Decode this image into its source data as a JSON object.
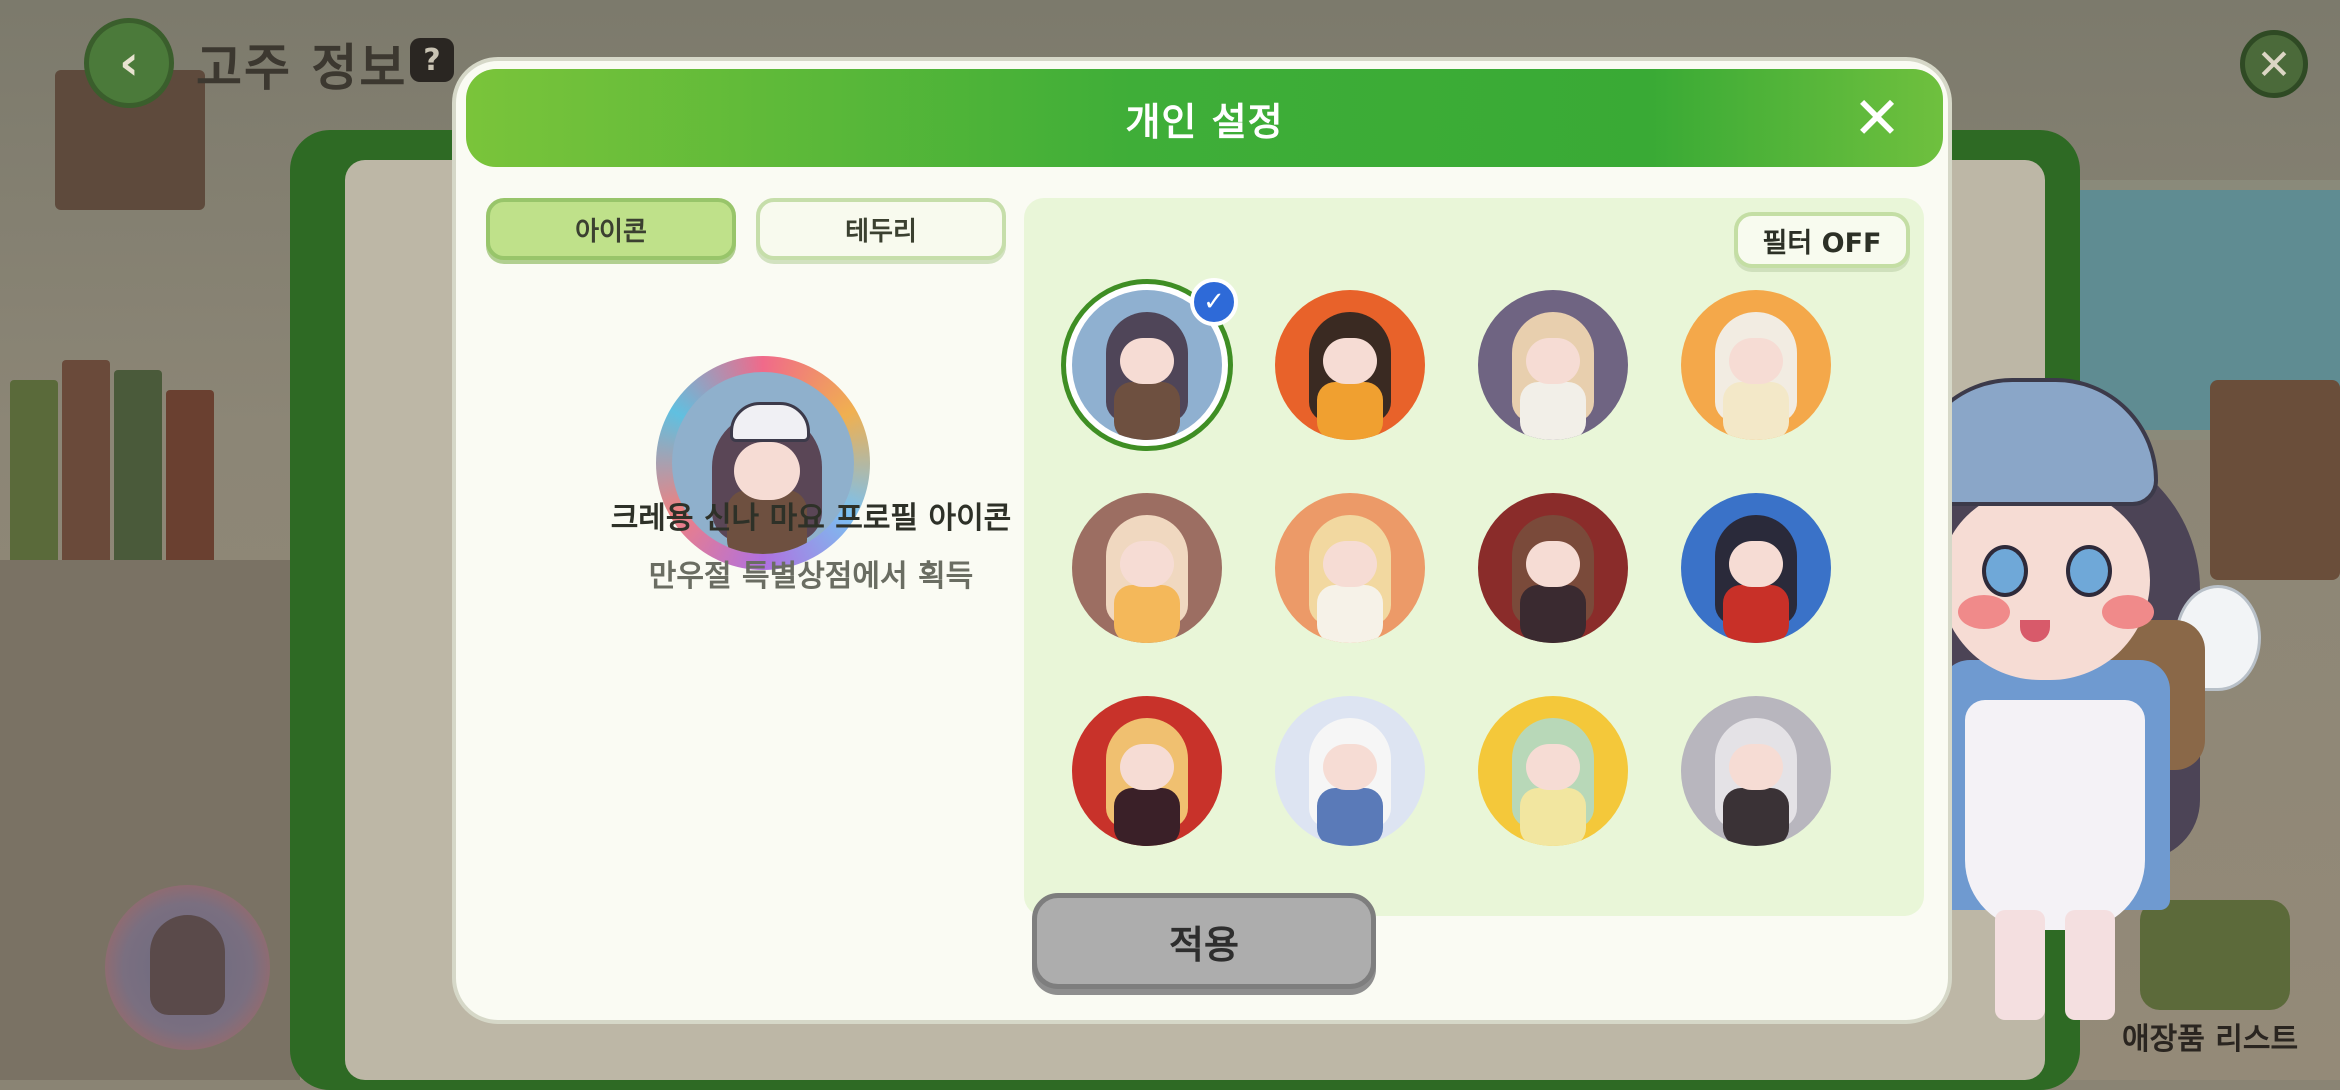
{
  "background": {
    "header_title": "고주 정보",
    "help_icon": "question-book-icon",
    "accessory_list_label": "애장품 리스트"
  },
  "modal": {
    "title": "개인 설정",
    "tabs": [
      {
        "label": "아이콘",
        "active": true
      },
      {
        "label": "테두리",
        "active": false
      }
    ],
    "selected_item": {
      "name": "크레용 신나 마요 프로필 아이콘",
      "source": "만우절 특별상점에서 획득"
    },
    "filter_label": "필터 OFF",
    "apply_label": "적용"
  },
  "icons": [
    {
      "id": "icon-1",
      "bg": "#8fb0d0",
      "hair": "#4f4558",
      "body": "#6e5040",
      "selected": true
    },
    {
      "id": "icon-2",
      "bg": "#e8622a",
      "hair": "#3a2a22",
      "body": "#f0a030",
      "selected": false
    },
    {
      "id": "icon-3",
      "bg": "#6f6482",
      "hair": "#e8cfae",
      "body": "#f2efe8",
      "selected": false
    },
    {
      "id": "icon-4",
      "bg": "#f4a84a",
      "hair": "#f2ece2",
      "body": "#f3e8c8",
      "selected": false
    },
    {
      "id": "icon-5",
      "bg": "#9c6e62",
      "hair": "#f0d8c0",
      "body": "#f4b85a",
      "selected": false
    },
    {
      "id": "icon-6",
      "bg": "#ec9a68",
      "hair": "#f2d8a0",
      "body": "#f6f2e8",
      "selected": false
    },
    {
      "id": "icon-7",
      "bg": "#8a2c2a",
      "hair": "#7a4a3a",
      "body": "#3a2a30",
      "selected": false
    },
    {
      "id": "icon-8",
      "bg": "#3a72c8",
      "hair": "#2a2a3a",
      "body": "#c83028",
      "selected": false
    },
    {
      "id": "icon-9",
      "bg": "#c8322a",
      "hair": "#f0c070",
      "body": "#3a2028",
      "selected": false
    },
    {
      "id": "icon-10",
      "bg": "#dde4f2",
      "hair": "#f6f6f6",
      "body": "#5a7ab8",
      "selected": false
    },
    {
      "id": "icon-11",
      "bg": "#f4c83a",
      "hair": "#b8d8b8",
      "body": "#f2e6a0",
      "selected": false
    },
    {
      "id": "icon-12",
      "bg": "#b8b6be",
      "hair": "#e4e2e6",
      "body": "#3a3236",
      "selected": false
    }
  ],
  "colors": {
    "header_green": "#3fae38",
    "tab_active": "#bfe18a",
    "panel_bg": "#e9f6d8",
    "selected_ring": "#3f8e24",
    "check_badge": "#2e6ad8",
    "apply_disabled": "#adadad"
  }
}
